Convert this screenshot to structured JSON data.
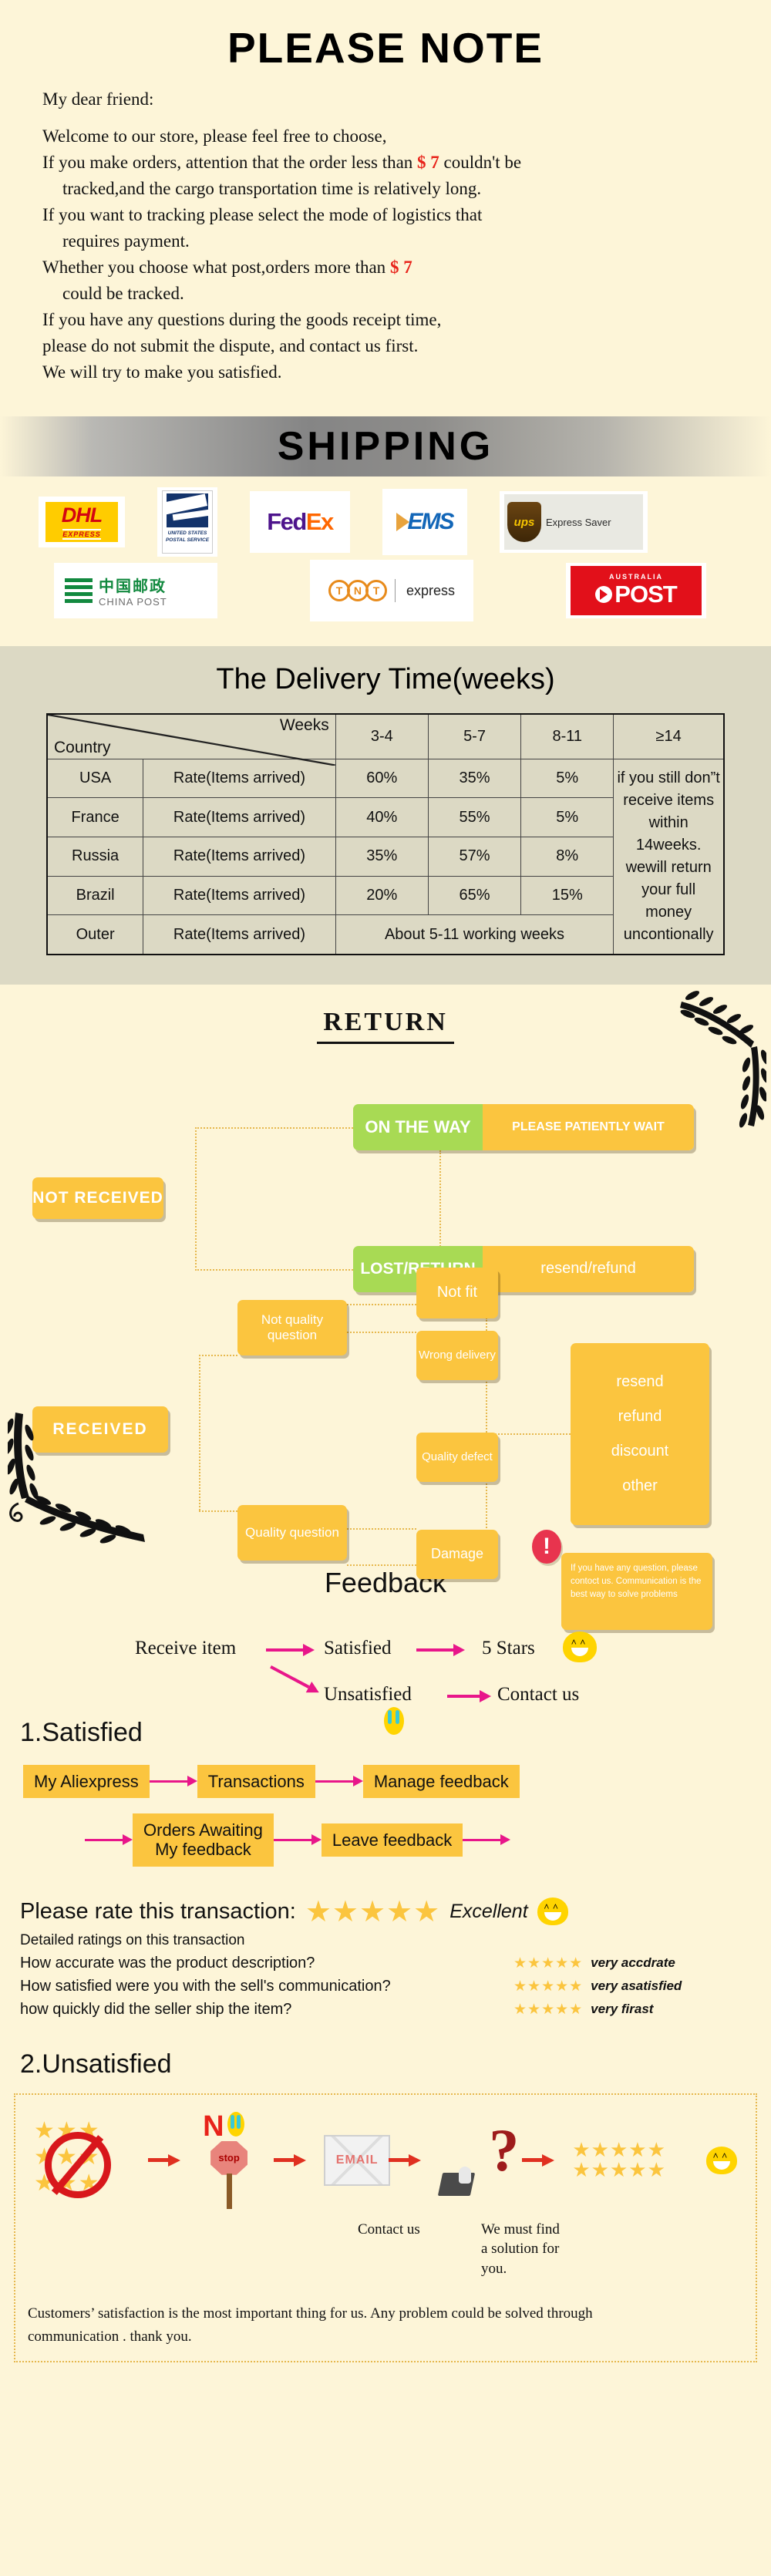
{
  "note": {
    "title": "PLEASE NOTE",
    "greeting": "My dear friend:",
    "lines": [
      "Welcome to our store, please feel free to choose,",
      "If you make orders, attention that the order less than ",
      " couldn't be",
      "tracked,and the cargo transportation time is relatively long.",
      "If you want to tracking please select the mode of logistics that",
      "requires payment.",
      "Whether you choose what post,orders more than ",
      "could be tracked.",
      "If you have any questions during the goods receipt time,",
      "please do not submit the dispute, and contact us first.",
      "We will try to make you satisfied."
    ],
    "price_1": "$ 7",
    "price_2": "$ 7",
    "price_color": "#e8231a"
  },
  "shipping": {
    "banner_title": "SHIPPING",
    "carriers": [
      {
        "name": "DHL",
        "sub": "EXPRESS"
      },
      {
        "name": "USPS",
        "sub": "UNITED STATES POSTAL SERVICE"
      },
      {
        "name": "FedEx",
        "sub": ""
      },
      {
        "name": "EMS",
        "sub": ""
      },
      {
        "name": "UPS",
        "sub": "Express Saver"
      },
      {
        "name": "CHINA POST",
        "sub": "中国邮政"
      },
      {
        "name": "TNT",
        "sub": "express"
      },
      {
        "name": "AUSTRALIA POST",
        "sub": "AUSTRALIA"
      }
    ],
    "dhl_text": "DHL",
    "dhl_sub": "EXPRESS",
    "usps_sub": "UNITED STATES POSTAL SERVICE",
    "fedex_a": "Fed",
    "fedex_b": "Ex",
    "ems_text": "EMS",
    "ups_text": "ups",
    "ups_label": "Express Saver",
    "chinapost_cn": "中国邮政",
    "chinapost_en": "CHINA POST",
    "tnt_letters": [
      "T",
      "N",
      "T"
    ],
    "tnt_express": "express",
    "aupost_top": "AUSTRALIA",
    "aupost_main": "POST"
  },
  "delivery": {
    "title": "The Delivery Time(weeks)",
    "corner_top": "Weeks",
    "corner_bottom": "Country",
    "columns": [
      "3-4",
      "5-7",
      "8-11",
      "≥14"
    ],
    "rate_label": "Rate(Items arrived)",
    "rows": [
      {
        "country": "USA",
        "rate": "Rate(Items arrived)",
        "values": [
          "60%",
          "35%",
          "5%"
        ]
      },
      {
        "country": "France",
        "rate": "Rate(Items arrived)",
        "values": [
          "40%",
          "55%",
          "5%"
        ]
      },
      {
        "country": "Russia",
        "rate": "Rate(Items arrived)",
        "values": [
          "35%",
          "57%",
          "8%"
        ]
      },
      {
        "country": "Brazil",
        "rate": "Rate(Items arrived)",
        "values": [
          "20%",
          "65%",
          "15%"
        ]
      }
    ],
    "outer_row": {
      "country": "Outer",
      "rate": "Rate(Items arrived)",
      "span_text": "About 5-11 working weeks"
    },
    "side_note": "if you still don”t receive items within 14weeks. wewill return your full money uncontionally"
  },
  "returns": {
    "title": "RETURN",
    "not_received": "NOT RECEIVED",
    "received": "RECEIVED",
    "on_the_way": "ON THE WAY",
    "on_the_way_action": "PLEASE PATIENTLY WAIT",
    "lost_return": "LOST/RETURN",
    "lost_return_action": "resend/refund",
    "not_quality_question": "Not quality question",
    "quality_question": "Quality question",
    "not_fit": "Not fit",
    "wrong_delivery": "Wrong delivery",
    "quality_defect": "Quality defect",
    "damage": "Damage",
    "outcomes": [
      "resend",
      "refund",
      "discount",
      "other"
    ],
    "alert_icon": "!",
    "alert_text": "If you have any question, please contoct us. Communication is the best way to solve problems"
  },
  "feedback": {
    "title": "Feedback",
    "receive_item": "Receive item",
    "satisfied": "Satisfied",
    "five_stars": "5 Stars",
    "unsatisfied": "Unsatisfied",
    "contact_us": "Contact us"
  },
  "satisfied": {
    "heading": "1.Satisfied",
    "steps_row1": [
      "My Aliexpress",
      "Transactions",
      "Manage feedback"
    ],
    "steps_row2": [
      "Orders Awaiting My feedback",
      "Leave feedback"
    ],
    "orders_awaiting_l1": "Orders Awaiting",
    "orders_awaiting_l2": "My feedback",
    "leave_feedback": "Leave feedback"
  },
  "ratings": {
    "prompt": "Please rate this transaction:",
    "overall_stars": "★★★★★",
    "overall_label": "Excellent",
    "detail_heading": "Detailed ratings on this transaction",
    "rows": [
      {
        "question": "How accurate was the product description?",
        "stars": "★★★★★",
        "verdict": "very accdrate"
      },
      {
        "question": "How satisfied were you with the sell's communication?",
        "stars": "★★★★★",
        "verdict": "very asatisfied"
      },
      {
        "question": "how quickly did the seller ship the item?",
        "stars": "★★★★★",
        "verdict": "very firast"
      }
    ]
  },
  "unsatisfied": {
    "heading": "2.Unsatisfied",
    "n_letter": "N",
    "stop_label": "stop",
    "email_label": "EMAIL",
    "question_mark": "?",
    "caption_contact": "Contact us",
    "caption_solution_l1": "We must find",
    "caption_solution_l2": "a solution for",
    "caption_solution_l3": "you.",
    "footer_l1": "Customers’ satisfaction is the most important thing for us. Any problem could be solved through",
    "footer_l2": "communication . thank you."
  },
  "colors": {
    "page_bg": "#fdf5d8",
    "yellow": "#fbc53f",
    "green": "#a8da54",
    "pink_arrow": "#e8168a",
    "red": "#e8231a",
    "table_bg": "#dcd9c4"
  }
}
